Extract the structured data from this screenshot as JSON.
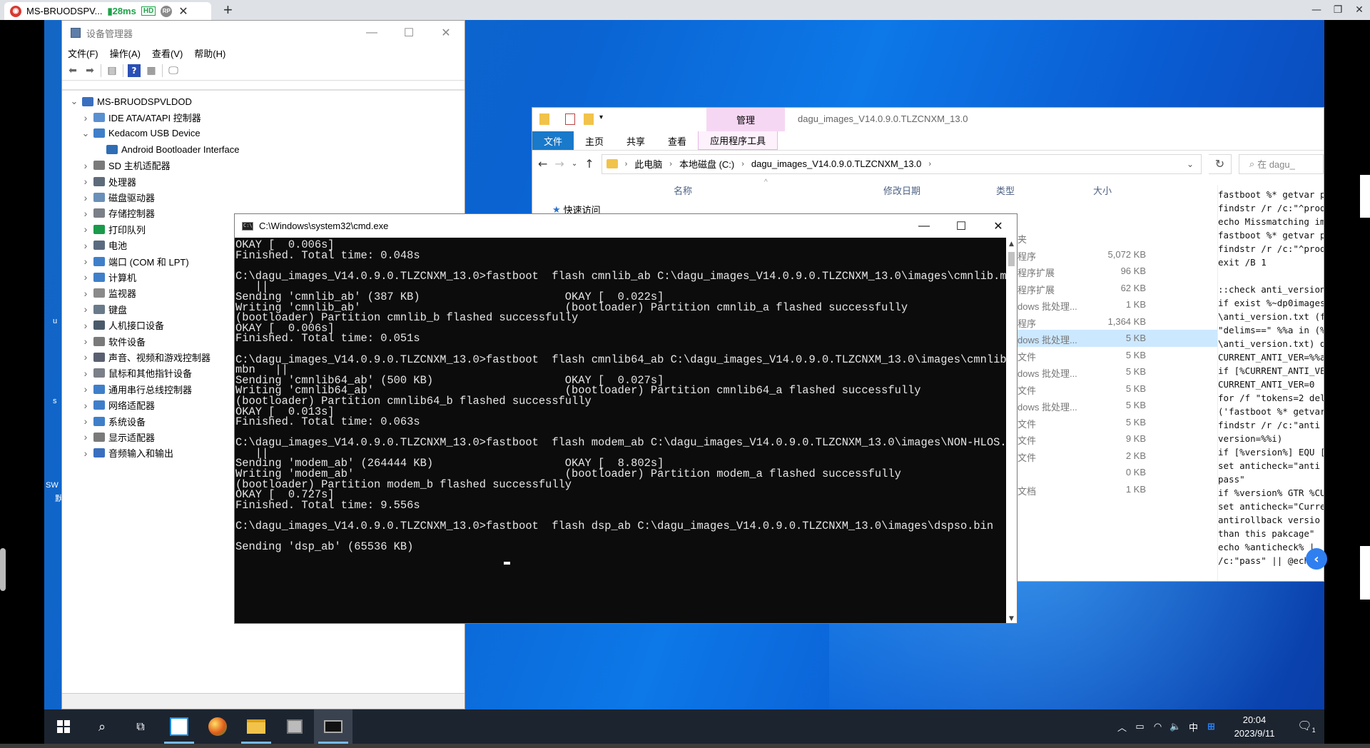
{
  "remote_bar": {
    "tab_title": "MS-BRUODSPV...",
    "latency": "28ms",
    "hd_badge": "HD",
    "rp_badge": "RP"
  },
  "desktop_fragments": [
    "u",
    "s",
    "SW",
    "默"
  ],
  "device_manager": {
    "title": "设备管理器",
    "menu": [
      "文件(F)",
      "操作(A)",
      "查看(V)",
      "帮助(H)"
    ],
    "tree": [
      {
        "label": "MS-BRUODSPVLDOD",
        "level": 0,
        "expanded": true
      },
      {
        "label": "IDE ATA/ATAPI 控制器",
        "level": 1,
        "expanded": false
      },
      {
        "label": "Kedacom USB Device",
        "level": 1,
        "expanded": true
      },
      {
        "label": "Android Bootloader Interface",
        "level": 2,
        "expanded": null
      },
      {
        "label": "SD 主机适配器",
        "level": 1,
        "expanded": false
      },
      {
        "label": "处理器",
        "level": 1,
        "expanded": false
      },
      {
        "label": "磁盘驱动器",
        "level": 1,
        "expanded": false
      },
      {
        "label": "存储控制器",
        "level": 1,
        "expanded": false
      },
      {
        "label": "打印队列",
        "level": 1,
        "expanded": false
      },
      {
        "label": "电池",
        "level": 1,
        "expanded": false
      },
      {
        "label": "端口 (COM 和 LPT)",
        "level": 1,
        "expanded": false
      },
      {
        "label": "计算机",
        "level": 1,
        "expanded": false
      },
      {
        "label": "监视器",
        "level": 1,
        "expanded": false
      },
      {
        "label": "键盘",
        "level": 1,
        "expanded": false
      },
      {
        "label": "人机接口设备",
        "level": 1,
        "expanded": false
      },
      {
        "label": "软件设备",
        "level": 1,
        "expanded": false
      },
      {
        "label": "声音、视频和游戏控制器",
        "level": 1,
        "expanded": false
      },
      {
        "label": "鼠标和其他指针设备",
        "level": 1,
        "expanded": false
      },
      {
        "label": "通用串行总线控制器",
        "level": 1,
        "expanded": false
      },
      {
        "label": "网络适配器",
        "level": 1,
        "expanded": false
      },
      {
        "label": "系统设备",
        "level": 1,
        "expanded": false
      },
      {
        "label": "显示适配器",
        "level": 1,
        "expanded": false
      },
      {
        "label": "音频输入和输出",
        "level": 1,
        "expanded": false
      }
    ]
  },
  "explorer": {
    "manage_tab": "管理",
    "title": "dagu_images_V14.0.9.0.TLZCNXM_13.0",
    "ribbon_tabs": [
      "文件",
      "主页",
      "共享",
      "查看"
    ],
    "tools_tab": "应用程序工具",
    "breadcrumb": [
      "此电脑",
      "本地磁盘 (C:)",
      "dagu_images_V14.0.9.0.TLZCNXM_13.0"
    ],
    "search_placeholder": "在 dagu_",
    "columns": {
      "name": "名称",
      "date": "修改日期",
      "type": "类型",
      "size": "大小"
    },
    "nav_quick_access": "快速访问",
    "rows": [
      {
        "type": "夹",
        "size": "",
        "selected": false
      },
      {
        "type": "程序",
        "size": "5,072 KB",
        "selected": false
      },
      {
        "type": "程序扩展",
        "size": "96 KB",
        "selected": false
      },
      {
        "type": "程序扩展",
        "size": "62 KB",
        "selected": false
      },
      {
        "type": "dows 批处理...",
        "size": "1 KB",
        "selected": false
      },
      {
        "type": "程序",
        "size": "1,364 KB",
        "selected": false
      },
      {
        "type": "dows 批处理...",
        "size": "5 KB",
        "selected": true
      },
      {
        "type": "文件",
        "size": "5 KB",
        "selected": false
      },
      {
        "type": "dows 批处理...",
        "size": "5 KB",
        "selected": false
      },
      {
        "type": "文件",
        "size": "5 KB",
        "selected": false
      },
      {
        "type": "dows 批处理...",
        "size": "5 KB",
        "selected": false
      },
      {
        "type": "文件",
        "size": "5 KB",
        "selected": false
      },
      {
        "type": "文件",
        "size": "9 KB",
        "selected": false
      },
      {
        "type": "文件",
        "size": "2 KB",
        "selected": false
      },
      {
        "type": "",
        "size": "0 KB",
        "selected": false
      },
      {
        "type": "文档",
        "size": "1 KB",
        "selected": false
      }
    ],
    "preview_text": "fastboot %* getvar p\nfindstr /r /c:\"^prod\necho Missmatching im\nfastboot %* getvar p\nfindstr /r /c:\"^prod\nexit /B 1\n\n::check anti_version\nif exist %~dp0images\n\\anti_version.txt (f\n\"delims==\" %%a in (%\n\\anti_version.txt) d\nCURRENT_ANTI_VER=%%a\nif [%CURRENT_ANTI_VE\nCURRENT_ANTI_VER=0\nfor /f \"tokens=2 del\n('fastboot %* getvar\nfindstr /r /c:\"anti\nversion=%%i)\nif [%version%] EQU [\nset anticheck=\"anti\npass\"\nif %version% GTR %CU\nset anticheck=\"Curre\nantirollback versio\nthan this pakcage\"\necho %anticheck% |\n/c:\"pass\" || @ech"
  },
  "cmd": {
    "title": "C:\\Windows\\system32\\cmd.exe",
    "lines": [
      "OKAY [  0.006s]",
      "Finished. Total time: 0.048s",
      "",
      "C:\\dagu_images_V14.0.9.0.TLZCNXM_13.0>fastboot  flash cmnlib_ab C:\\dagu_images_V14.0.9.0.TLZCNXM_13.0\\images\\cmnlib.mbn",
      "   ||",
      "Sending 'cmnlib_ab' (387 KB)                      OKAY [  0.022s]",
      "Writing 'cmnlib_ab'                               (bootloader) Partition cmnlib_a flashed successfully",
      "(bootloader) Partition cmnlib_b flashed successfully",
      "OKAY [  0.006s]",
      "Finished. Total time: 0.051s",
      "",
      "C:\\dagu_images_V14.0.9.0.TLZCNXM_13.0>fastboot  flash cmnlib64_ab C:\\dagu_images_V14.0.9.0.TLZCNXM_13.0\\images\\cmnlib64.",
      "mbn   ||",
      "Sending 'cmnlib64_ab' (500 KB)                    OKAY [  0.027s]",
      "Writing 'cmnlib64_ab'                             (bootloader) Partition cmnlib64_a flashed successfully",
      "(bootloader) Partition cmnlib64_b flashed successfully",
      "OKAY [  0.013s]",
      "Finished. Total time: 0.063s",
      "",
      "C:\\dagu_images_V14.0.9.0.TLZCNXM_13.0>fastboot  flash modem_ab C:\\dagu_images_V14.0.9.0.TLZCNXM_13.0\\images\\NON-HLOS.bin",
      "   ||",
      "Sending 'modem_ab' (264444 KB)                    OKAY [  8.802s]",
      "Writing 'modem_ab'                                (bootloader) Partition modem_a flashed successfully",
      "(bootloader) Partition modem_b flashed successfully",
      "OKAY [  0.727s]",
      "Finished. Total time: 9.556s",
      "",
      "C:\\dagu_images_V14.0.9.0.TLZCNXM_13.0>fastboot  flash dsp_ab C:\\dagu_images_V14.0.9.0.TLZCNXM_13.0\\images\\dspso.bin   ||",
      "",
      "Sending 'dsp_ab' (65536 KB)"
    ]
  },
  "taskbar": {
    "time": "20:04",
    "date": "2023/9/11",
    "ime": "中",
    "notification_count": "1",
    "apps": [
      {
        "icon": "start-icon",
        "active": false
      },
      {
        "icon": "search-icon",
        "active": false
      },
      {
        "icon": "task-view-icon",
        "active": false
      },
      {
        "icon": "app-icon",
        "active": true
      },
      {
        "icon": "globe-icon",
        "active": false
      },
      {
        "icon": "folder-icon",
        "active": true
      },
      {
        "icon": "network-tool-icon",
        "active": false
      },
      {
        "icon": "terminal-icon",
        "active": true
      }
    ]
  }
}
